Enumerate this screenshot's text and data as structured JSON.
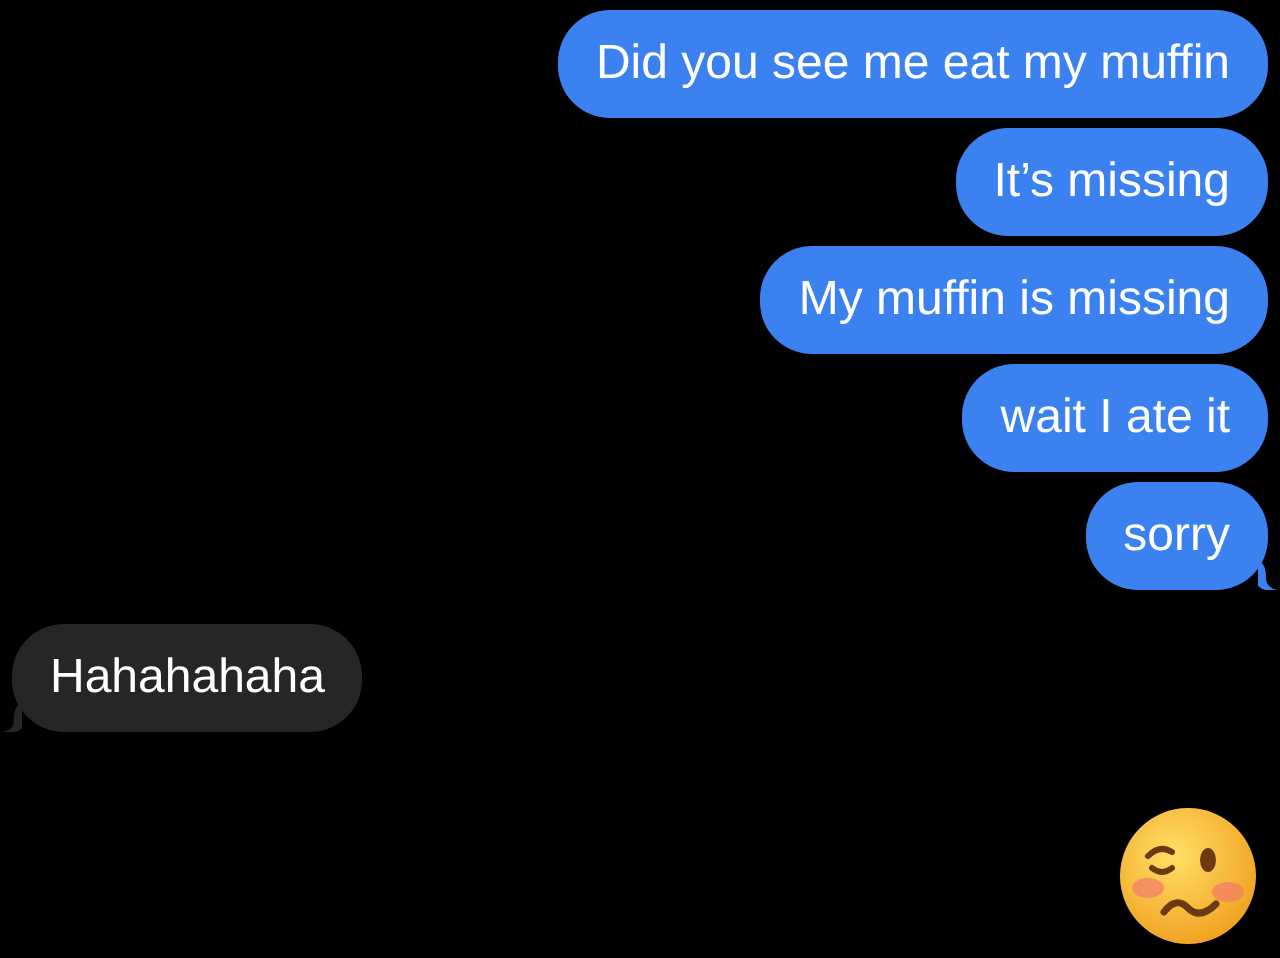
{
  "messages": [
    {
      "kind": "sent",
      "text": "Did you see me eat my muffin",
      "tail": false
    },
    {
      "kind": "sent",
      "text": "It’s missing",
      "tail": false
    },
    {
      "kind": "sent",
      "text": "My muffin is missing",
      "tail": false
    },
    {
      "kind": "sent",
      "text": "wait I ate it",
      "tail": false
    },
    {
      "kind": "sent",
      "text": "sorry",
      "tail": true
    },
    {
      "kind": "received",
      "text": "Hahahahaha",
      "tail": true
    },
    {
      "kind": "emoji"
    }
  ]
}
